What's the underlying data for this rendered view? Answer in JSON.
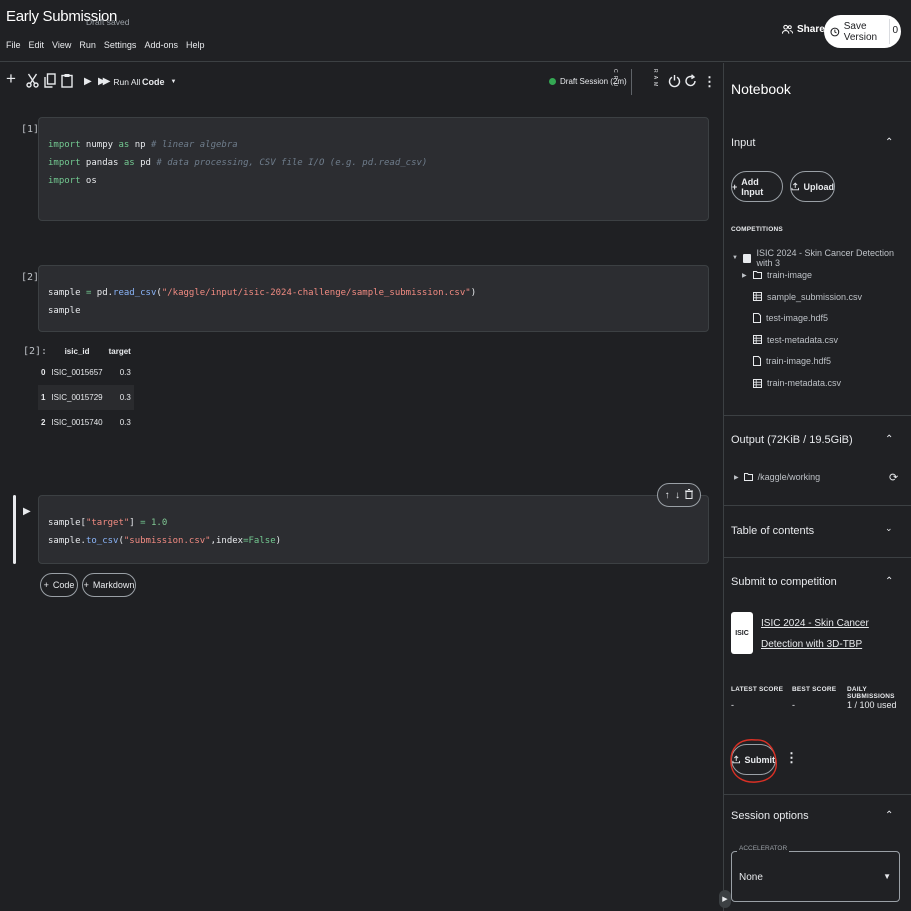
{
  "header": {
    "title": "Early Submission",
    "draft_status": "Draft saved",
    "menu": [
      "File",
      "Edit",
      "View",
      "Run",
      "Settings",
      "Add-ons",
      "Help"
    ],
    "share_label": "Share",
    "save_version_label": "Save Version",
    "save_version_count": "0"
  },
  "toolbar": {
    "run_all_label": "Run All",
    "cell_type": "Code",
    "session_label": "Draft Session (2m)",
    "metrics": [
      "C P U",
      "R A M"
    ]
  },
  "cells": [
    {
      "prompt": "[1]:",
      "lines": [
        [
          {
            "t": "import",
            "c": "kw"
          },
          {
            "t": " numpy "
          },
          {
            "t": "as",
            "c": "kw"
          },
          {
            "t": " np "
          },
          {
            "t": "# linear algebra",
            "c": "cm"
          }
        ],
        [
          {
            "t": "import",
            "c": "kw"
          },
          {
            "t": " pandas "
          },
          {
            "t": "as",
            "c": "kw"
          },
          {
            "t": " pd "
          },
          {
            "t": "# data processing, CSV file I/O (e.g. pd.read_csv)",
            "c": "cm"
          }
        ],
        [
          {
            "t": "import",
            "c": "kw"
          },
          {
            "t": " os"
          }
        ]
      ]
    },
    {
      "prompt": "[2]:",
      "lines": [
        [
          {
            "t": "sample "
          },
          {
            "t": "=",
            "c": "kw"
          },
          {
            "t": " pd."
          },
          {
            "t": "read_csv",
            "c": "fn"
          },
          {
            "t": "("
          },
          {
            "t": "\"/kaggle/input/isic-2024-challenge/sample_submission.csv\"",
            "c": "str"
          },
          {
            "t": ")"
          }
        ],
        [
          {
            "t": "sample"
          }
        ]
      ]
    },
    {
      "prompt": "",
      "lines": [
        [
          {
            "t": "sample["
          },
          {
            "t": "\"target\"",
            "c": "str"
          },
          {
            "t": "] "
          },
          {
            "t": "=",
            "c": "kw"
          },
          {
            "t": " "
          },
          {
            "t": "1.0",
            "c": "num"
          }
        ],
        [
          {
            "t": "sample."
          },
          {
            "t": "to_csv",
            "c": "fn"
          },
          {
            "t": "("
          },
          {
            "t": "\"submission.csv\"",
            "c": "str"
          },
          {
            "t": ",index"
          },
          {
            "t": "=",
            "c": "kw"
          },
          {
            "t": "False",
            "c": "kw"
          },
          {
            "t": ")"
          }
        ]
      ]
    }
  ],
  "output": {
    "prompt": "[2]:",
    "columns": [
      "",
      "isic_id",
      "target"
    ],
    "rows": [
      [
        "0",
        "ISIC_0015657",
        "0.3"
      ],
      [
        "1",
        "ISIC_0015729",
        "0.3"
      ],
      [
        "2",
        "ISIC_0015740",
        "0.3"
      ]
    ]
  },
  "add_cell": {
    "code": "Code",
    "markdown": "Markdown"
  },
  "panel": {
    "title": "Notebook",
    "input": {
      "title": "Input",
      "add_input": "Add Input",
      "upload": "Upload",
      "competitions_label": "COMPETITIONS",
      "competition_name": "ISIC 2024 - Skin Cancer Detection with 3",
      "files": [
        {
          "name": "train-image",
          "icon": "folder-icon",
          "expand": true
        },
        {
          "name": "sample_submission.csv",
          "icon": "table-icon"
        },
        {
          "name": "test-image.hdf5",
          "icon": "file-icon"
        },
        {
          "name": "test-metadata.csv",
          "icon": "table-icon"
        },
        {
          "name": "train-image.hdf5",
          "icon": "file-icon"
        },
        {
          "name": "train-metadata.csv",
          "icon": "table-icon"
        }
      ]
    },
    "output": {
      "title": "Output (72KiB / 19.5GiB)",
      "path": "/kaggle/working"
    },
    "toc": {
      "title": "Table of contents"
    },
    "submit": {
      "title": "Submit to competition",
      "competition_link": "ISIC 2024 - Skin Cancer Detection with 3D-TBP",
      "logo_text": "ISIC",
      "latest_score_label": "LATEST SCORE",
      "latest_score": "-",
      "best_score_label": "BEST SCORE",
      "best_score": "-",
      "daily_label": "DAILY SUBMISSIONS",
      "daily_value": "1 / 100 used",
      "submit_label": "Submit"
    },
    "session": {
      "title": "Session options",
      "accelerator_label": "ACCELERATOR",
      "accelerator_value": "None"
    }
  },
  "colors": {
    "accent_green": "#34a853",
    "annotation_red": "#d93025"
  }
}
